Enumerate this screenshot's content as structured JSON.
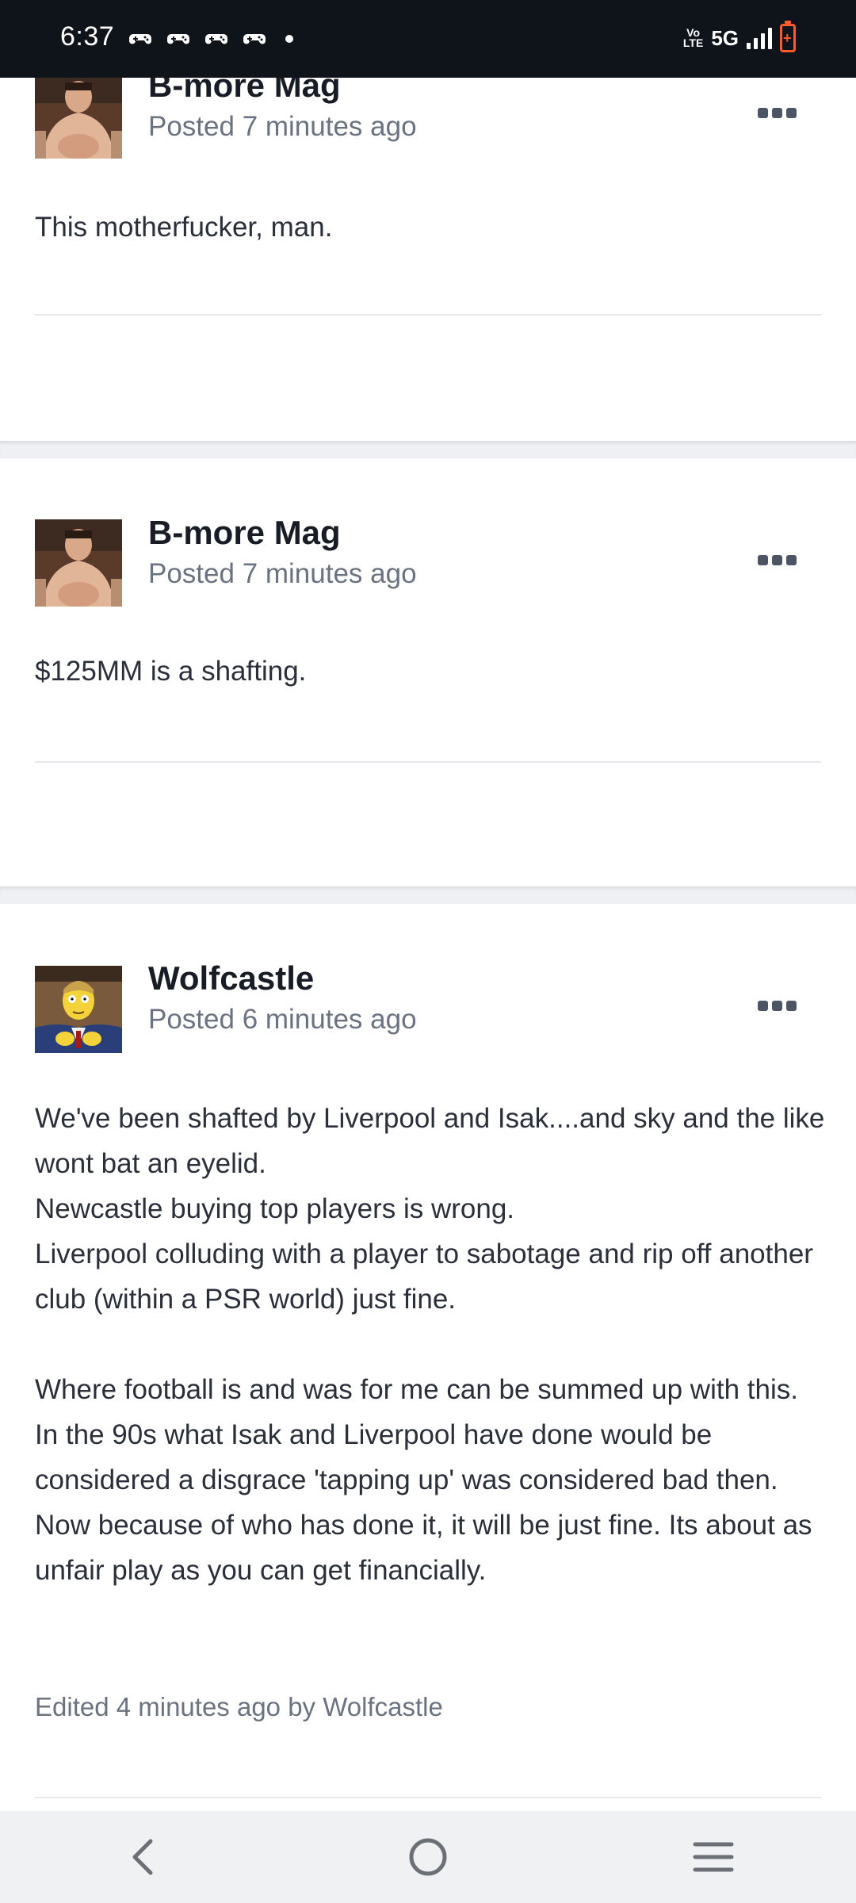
{
  "status_bar": {
    "time": "6:37",
    "notification_icons": [
      "game-controller-icon",
      "game-controller-icon",
      "game-controller-icon",
      "game-controller-icon"
    ],
    "volte_label": "Vo LTE",
    "network": "5G",
    "battery_color": "#ff5a2c"
  },
  "posts": [
    {
      "author": "B-more Mag",
      "posted": "Posted 7 minutes ago",
      "body": [
        "This motherfucker, man."
      ]
    },
    {
      "author": "B-more Mag",
      "posted": "Posted 7 minutes ago",
      "body": [
        "$125MM is a shafting."
      ]
    },
    {
      "author": "Wolfcastle",
      "posted": "Posted 6 minutes ago",
      "body": [
        "We've been shafted by Liverpool and Isak....and sky and the like wont bat an eyelid.",
        "Newcastle buying top players is wrong.",
        "Liverpool colluding with a player to sabotage and rip off another club (within a PSR world) just fine.",
        "",
        "Where football is and was for me can be summed up with this. In the 90s what Isak and Liverpool have done would be considered a disgrace 'tapping up' was considered bad then. Now because of who has done it, it will be just fine. Its about as unfair play as you can get financially."
      ],
      "edited": "Edited 4 minutes ago by Wolfcastle"
    }
  ],
  "nav": {
    "back": "back-icon",
    "home": "home-icon",
    "recents": "menu-icon"
  }
}
